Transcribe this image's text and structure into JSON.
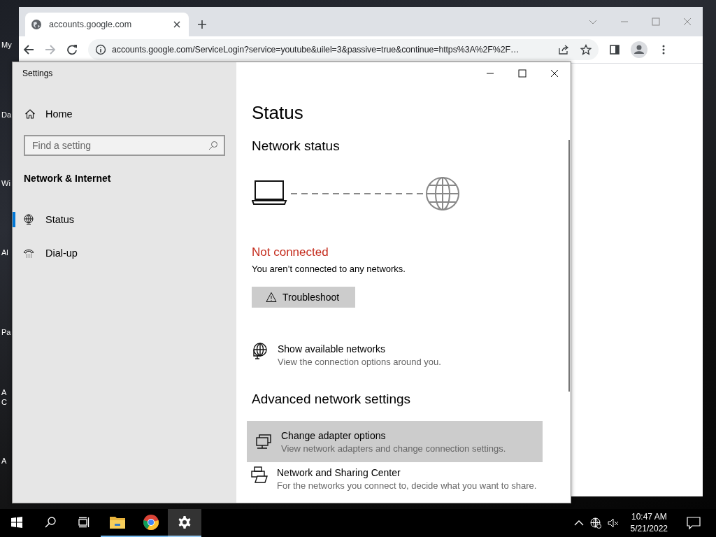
{
  "desktop": {
    "icon_labels": [
      "My",
      "Da",
      "Wi",
      "Al",
      "Pa",
      "A",
      "C",
      "A"
    ]
  },
  "browser": {
    "tab": {
      "title": "accounts.google.com"
    },
    "url": "accounts.google.com/ServiceLogin?service=youtube&uilel=3&passive=true&continue=https%3A%2F%2F…"
  },
  "settings": {
    "title": "Settings",
    "nav": {
      "home": "Home",
      "search_placeholder": "Find a setting",
      "section": "Network & Internet",
      "items": [
        {
          "label": "Status",
          "kind": "globe",
          "selected": true
        },
        {
          "label": "Dial-up",
          "kind": "dialup",
          "selected": false
        }
      ]
    },
    "main": {
      "heading": "Status",
      "subheading": "Network status",
      "status": "Not connected",
      "status_detail": "You aren’t connected to any networks.",
      "troubleshoot_button": "Troubleshoot",
      "links": [
        {
          "kind": "globe",
          "title": "Show available networks",
          "description": "View the connection options around you.",
          "highlighted": false
        }
      ],
      "advanced_heading": "Advanced network settings",
      "advanced_items": [
        {
          "kind": "adapter",
          "title": "Change adapter options",
          "description": "View network adapters and change connection settings.",
          "highlighted": true
        },
        {
          "kind": "sharing",
          "title": "Network and Sharing Center",
          "description": "For the networks you connect to, decide what you want to share.",
          "highlighted": false
        }
      ]
    }
  },
  "taskbar": {
    "apps": [
      {
        "kind": "start",
        "running": false,
        "active": false
      },
      {
        "kind": "search",
        "running": false,
        "active": false
      },
      {
        "kind": "taskview",
        "running": false,
        "active": false
      },
      {
        "kind": "explorer",
        "running": true,
        "active": false
      },
      {
        "kind": "chrome",
        "running": true,
        "active": false
      },
      {
        "kind": "settings",
        "running": true,
        "active": true
      }
    ],
    "time": "10:47 AM",
    "date": "5/21/2022"
  }
}
